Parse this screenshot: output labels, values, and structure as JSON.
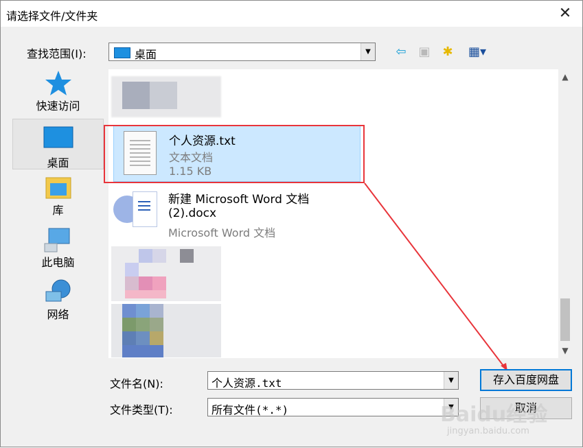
{
  "window": {
    "title": "请选择文件/文件夹",
    "close_glyph": "✕"
  },
  "lookin": {
    "label": "查找范围(I):",
    "value": "桌面"
  },
  "toolbar": {
    "back_glyph": "⇦",
    "up_glyph": "▣",
    "newfolder_glyph": "✱",
    "view_glyph": "▦▾"
  },
  "places": [
    {
      "label": "快速访问",
      "icon": "star-icon"
    },
    {
      "label": "桌面",
      "icon": "desktop-icon"
    },
    {
      "label": "库",
      "icon": "library-icon"
    },
    {
      "label": "此电脑",
      "icon": "computer-icon"
    },
    {
      "label": "网络",
      "icon": "network-icon"
    }
  ],
  "files": [
    {
      "name": "个人资源.txt",
      "type": "文本文档",
      "size": "1.15 KB",
      "selected": true
    },
    {
      "name_line1": "新建 Microsoft Word 文档",
      "name_line2": "(2).docx",
      "type": "Microsoft Word 文档"
    }
  ],
  "filename": {
    "label": "文件名(N):",
    "value": "个人资源.txt"
  },
  "filetype": {
    "label": "文件类型(T):",
    "value": "所有文件(*.*)"
  },
  "buttons": {
    "save": "存入百度网盘",
    "cancel": "取消"
  },
  "watermark": {
    "brand": "Baidu经验",
    "url": "jingyan.baidu.com"
  },
  "colors": {
    "accent": "#0078d7",
    "highlight_border": "#e8343a",
    "selection_bg": "#cce8ff"
  }
}
